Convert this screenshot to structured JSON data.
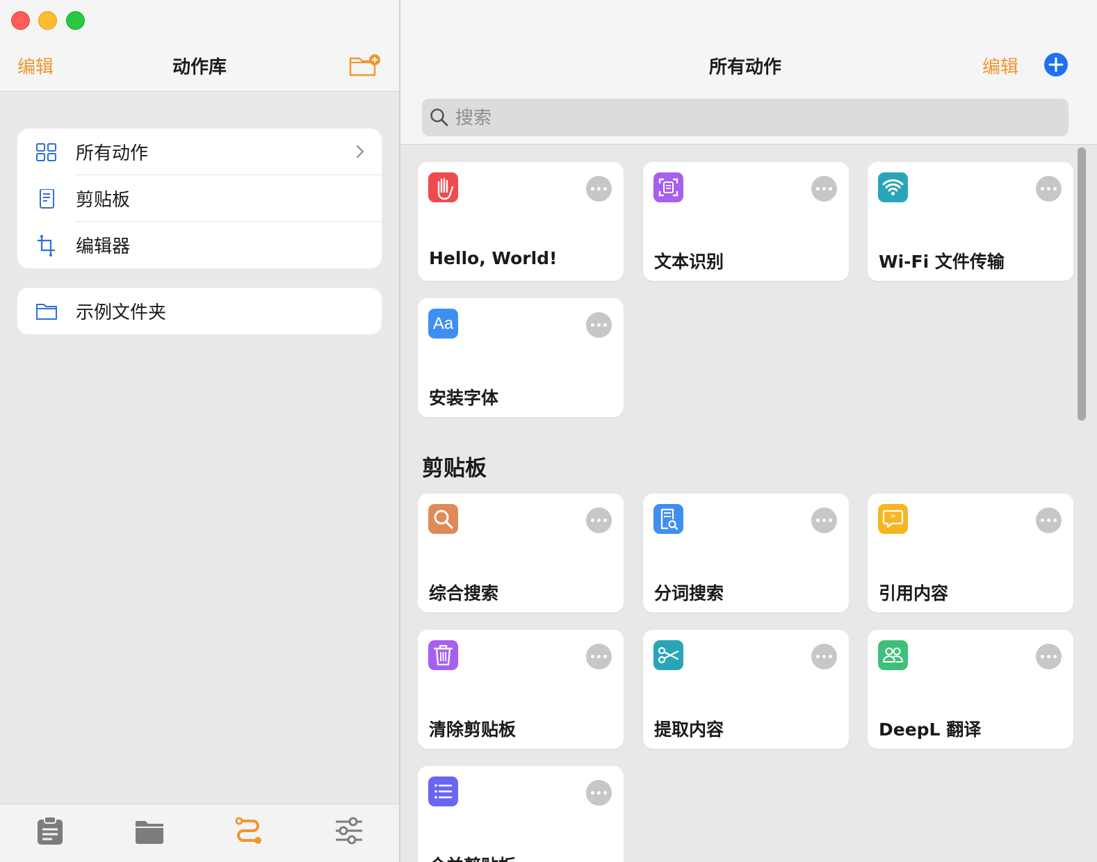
{
  "sidebar": {
    "edit_label": "编辑",
    "title": "动作库",
    "new_folder_icon": "folder-plus-icon",
    "items": [
      {
        "label": "所有动作",
        "icon": "grid-icon",
        "chevron": true
      },
      {
        "label": "剪贴板",
        "icon": "clipboard-doc-icon"
      },
      {
        "label": "编辑器",
        "icon": "crop-icon"
      }
    ],
    "folders": [
      {
        "label": "示例文件夹",
        "icon": "folder-icon"
      }
    ],
    "tabs": [
      "clipboard-tab-icon",
      "folder-tab-icon",
      "shortcuts-tab-icon",
      "settings-tab-icon"
    ],
    "active_tab": "shortcuts-tab-icon"
  },
  "main": {
    "title": "所有动作",
    "edit_label": "编辑",
    "add_icon": "plus-icon",
    "search": {
      "placeholder": "搜索",
      "value": ""
    },
    "section_clipboard": "剪贴板",
    "tiles": [
      {
        "label": "Hello, World!",
        "icon": "hand-icon",
        "color": "#ef4b4e"
      },
      {
        "label": "文本识别",
        "icon": "text-scan-icon",
        "color": "#a65ff0"
      },
      {
        "label": "Wi-Fi 文件传输",
        "icon": "wifi-icon",
        "color": "#2aa5b8"
      },
      {
        "label": "安装字体",
        "icon": "font-aa-icon",
        "color": "#3f8ff0"
      },
      {
        "label": "综合搜索",
        "icon": "magnifier-icon",
        "color": "#e08a5a"
      },
      {
        "label": "分词搜索",
        "icon": "doc-search-icon",
        "color": "#3f8ff0"
      },
      {
        "label": "引用内容",
        "icon": "quote-bubble-icon",
        "color": "#f8b522"
      },
      {
        "label": "清除剪贴板",
        "icon": "trash-icon",
        "color": "#a65ff0"
      },
      {
        "label": "提取内容",
        "icon": "scissors-icon",
        "color": "#2aa5b8"
      },
      {
        "label": "DeepL 翻译",
        "icon": "people-icon",
        "color": "#3fc07a"
      },
      {
        "label": "合并剪贴板",
        "icon": "list-icon",
        "color": "#6a67ef"
      }
    ]
  },
  "colors": {
    "accent": "#f0962e",
    "blue": "#1f6ff2",
    "sidebar_icon": "#2e6ed9"
  }
}
